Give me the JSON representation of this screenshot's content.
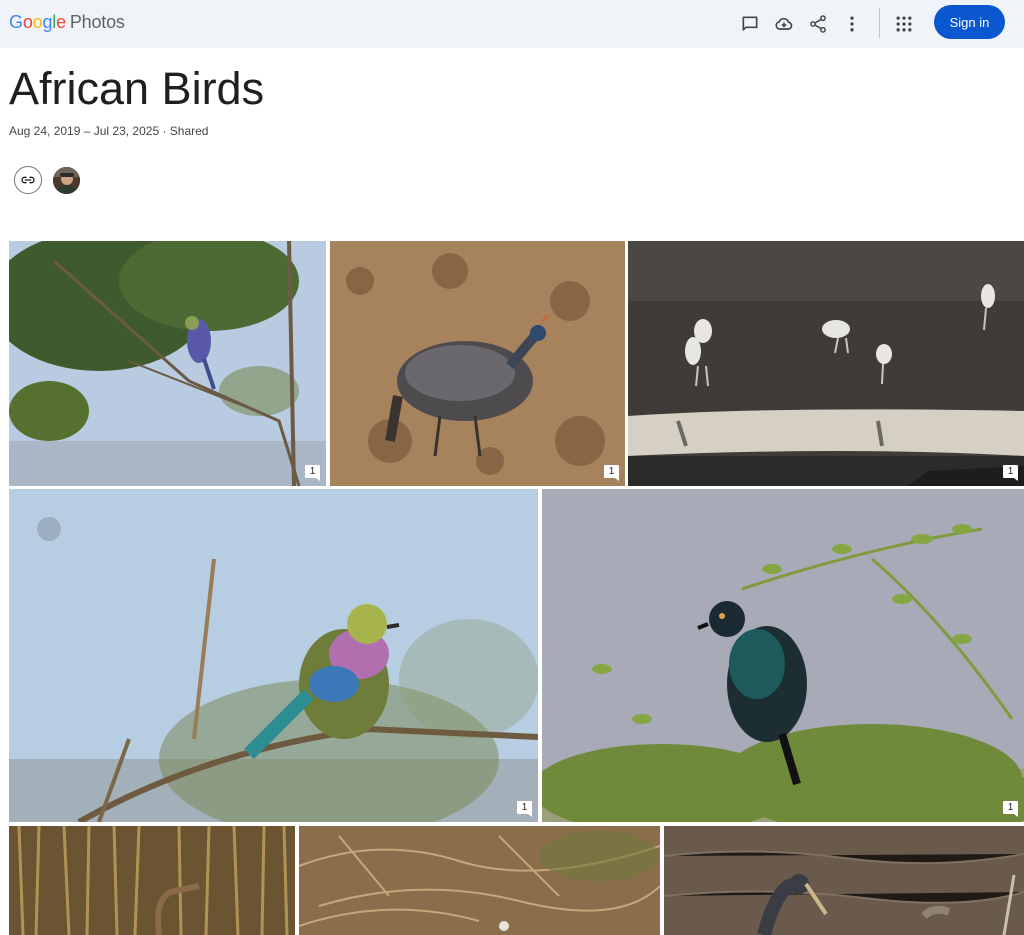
{
  "header": {
    "logo_google": "Google",
    "logo_product": "Photos",
    "sign_in_label": "Sign in",
    "icons": [
      "comment-icon",
      "cloud-download-icon",
      "share-icon",
      "more-vert-icon",
      "apps-grid-icon"
    ]
  },
  "album": {
    "title": "African Birds",
    "subtitle": "Aug 24, 2019 – Jul 23, 2025 · Shared"
  },
  "photos": [
    {
      "name": "lilac-breasted-roller-in-tree",
      "comments": "1"
    },
    {
      "name": "helmeted-guineafowl",
      "comments": "1"
    },
    {
      "name": "marabou-storks-at-water",
      "comments": "1"
    },
    {
      "name": "lilac-breasted-roller-closeup",
      "comments": "1"
    },
    {
      "name": "glossy-starling-on-bush",
      "comments": "1"
    },
    {
      "name": "heron-in-reeds",
      "comments": ""
    },
    {
      "name": "bird-in-brush",
      "comments": ""
    },
    {
      "name": "openbill-stork-in-water",
      "comments": ""
    }
  ],
  "colors": {
    "topbar_bg": "#f0f4f9",
    "sign_in_bg": "#0b57d0",
    "sign_in_text": "#ffffff"
  }
}
